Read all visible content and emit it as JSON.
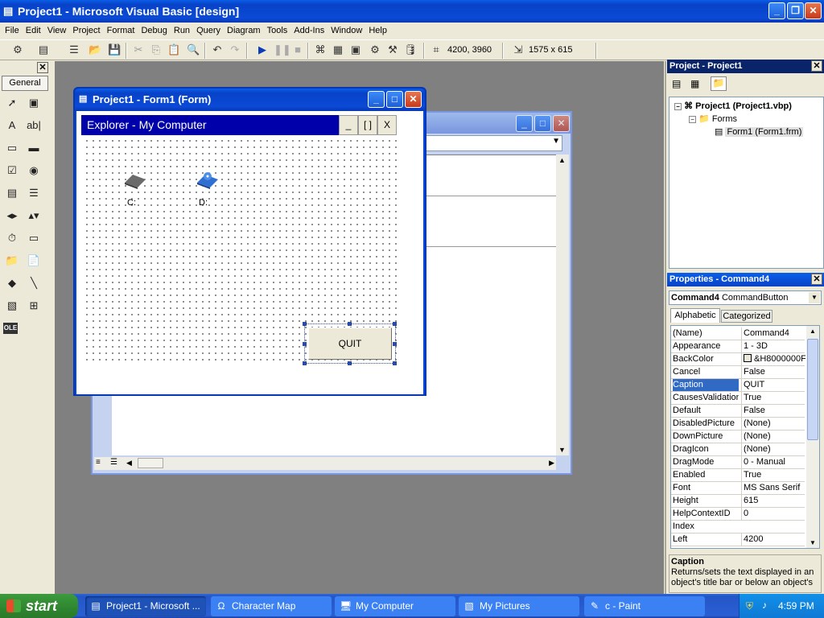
{
  "app": {
    "title": "Project1 - Microsoft Visual Basic [design]",
    "menu": [
      "File",
      "Edit",
      "View",
      "Project",
      "Format",
      "Debug",
      "Run",
      "Query",
      "Diagram",
      "Tools",
      "Add-Ins",
      "Window",
      "Help"
    ],
    "position_readout": "4200, 3960",
    "size_readout": "1575 x 615"
  },
  "toolbox": {
    "header": "General",
    "tools": [
      {
        "icon": "pointer-icon",
        "glyph": "➚"
      },
      {
        "icon": "picturebox-icon",
        "glyph": "▣"
      },
      {
        "icon": "label-icon",
        "glyph": "A"
      },
      {
        "icon": "textbox-icon",
        "glyph": "ab|"
      },
      {
        "icon": "frame-icon",
        "glyph": "▭"
      },
      {
        "icon": "commandbutton-icon",
        "glyph": "▬"
      },
      {
        "icon": "checkbox-icon",
        "glyph": "☑"
      },
      {
        "icon": "optionbutton-icon",
        "glyph": "◉"
      },
      {
        "icon": "combobox-icon",
        "glyph": "▤"
      },
      {
        "icon": "listbox-icon",
        "glyph": "☰"
      },
      {
        "icon": "hscrollbar-icon",
        "glyph": "◂▸"
      },
      {
        "icon": "vscrollbar-icon",
        "glyph": "▴▾"
      },
      {
        "icon": "timer-icon",
        "glyph": "⏱"
      },
      {
        "icon": "drivelistbox-icon",
        "glyph": "▭"
      },
      {
        "icon": "dirlistbox-icon",
        "glyph": "📁"
      },
      {
        "icon": "filelistbox-icon",
        "glyph": "📄"
      },
      {
        "icon": "shape-icon",
        "glyph": "◆"
      },
      {
        "icon": "line-icon",
        "glyph": "╲"
      },
      {
        "icon": "image-icon",
        "glyph": "▧"
      },
      {
        "icon": "data-icon",
        "glyph": "⊞"
      },
      {
        "icon": "ole-icon",
        "glyph": "OLE"
      }
    ]
  },
  "form_window": {
    "title": "Project1 - Form1 (Form)",
    "explorer_title": "Explorer - My Computer",
    "explorer_buttons": [
      "_",
      "[ ]",
      "X"
    ],
    "drives": [
      {
        "label": "C:",
        "icon": "hard-drive-icon"
      },
      {
        "label": "D:",
        "icon": "cd-drive-icon"
      }
    ],
    "quit_button": "QUIT"
  },
  "project_panel": {
    "title": "Project - Project1",
    "tree": {
      "project": "Project1 (Project1.vbp)",
      "folder": "Forms",
      "form": "Form1 (Form1.frm)"
    }
  },
  "properties_panel": {
    "title": "Properties - Command4",
    "object_name": "Command4",
    "object_type": "CommandButton",
    "tabs": [
      "Alphabetic",
      "Categorized"
    ],
    "rows": [
      {
        "name": "(Name)",
        "value": "Command4"
      },
      {
        "name": "Appearance",
        "value": "1 - 3D"
      },
      {
        "name": "BackColor",
        "value": "&H8000000F"
      },
      {
        "name": "Cancel",
        "value": "False"
      },
      {
        "name": "Caption",
        "value": "QUIT"
      },
      {
        "name": "CausesValidation",
        "value": "True"
      },
      {
        "name": "Default",
        "value": "False"
      },
      {
        "name": "DisabledPicture",
        "value": "(None)"
      },
      {
        "name": "DownPicture",
        "value": "(None)"
      },
      {
        "name": "DragIcon",
        "value": "(None)"
      },
      {
        "name": "DragMode",
        "value": "0 - Manual"
      },
      {
        "name": "Enabled",
        "value": "True"
      },
      {
        "name": "Font",
        "value": "MS Sans Serif"
      },
      {
        "name": "Height",
        "value": "615"
      },
      {
        "name": "HelpContextID",
        "value": "0"
      },
      {
        "name": "Index",
        "value": ""
      },
      {
        "name": "Left",
        "value": "4200"
      }
    ],
    "description_title": "Caption",
    "description_text": "Returns/sets the text displayed in an object's title bar or below an object's"
  },
  "taskbar": {
    "start": "start",
    "buttons": [
      {
        "label": "Project1 - Microsoft ...",
        "icon": "vb-icon",
        "glyph": "▤"
      },
      {
        "label": "Character Map",
        "icon": "charmap-icon",
        "glyph": "Ω"
      },
      {
        "label": "My Computer",
        "icon": "computer-icon",
        "glyph": "🖥"
      },
      {
        "label": "My Pictures",
        "icon": "folder-icon",
        "glyph": "▧"
      },
      {
        "label": "c - Paint",
        "icon": "paint-icon",
        "glyph": "✎"
      }
    ],
    "clock": "4:59 PM"
  }
}
